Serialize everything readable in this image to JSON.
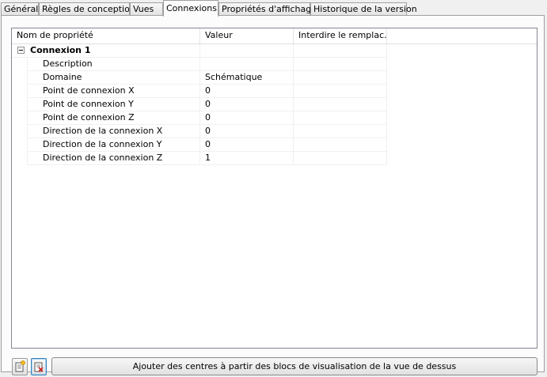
{
  "tabs": [
    {
      "label": "Général"
    },
    {
      "label": "Règles de conception"
    },
    {
      "label": "Vues"
    },
    {
      "label": "Connexions"
    },
    {
      "label": "Propriétés d'affichage"
    },
    {
      "label": "Historique de la version"
    }
  ],
  "active_tab": "Connexions",
  "grid": {
    "columns": [
      "Nom de propriété",
      "Valeur",
      "Interdire le remplac..."
    ],
    "group": {
      "label": "Connexion 1",
      "expanded": true
    },
    "rows": [
      {
        "name": "Description",
        "value": ""
      },
      {
        "name": "Domaine",
        "value": "Schématique"
      },
      {
        "name": "Point de connexion X",
        "value": "0"
      },
      {
        "name": "Point de connexion Y",
        "value": "0"
      },
      {
        "name": "Point de connexion Z",
        "value": "0"
      },
      {
        "name": "Direction de la connexion X",
        "value": "0"
      },
      {
        "name": "Direction de la connexion Y",
        "value": "0"
      },
      {
        "name": "Direction de la connexion Z",
        "value": "1"
      }
    ]
  },
  "buttons": {
    "add_icon": "add-connection-icon",
    "delete_icon": "delete-connection-icon",
    "main_label": "Ajouter des centres à partir des blocs de visualisation de la vue de dessus"
  }
}
